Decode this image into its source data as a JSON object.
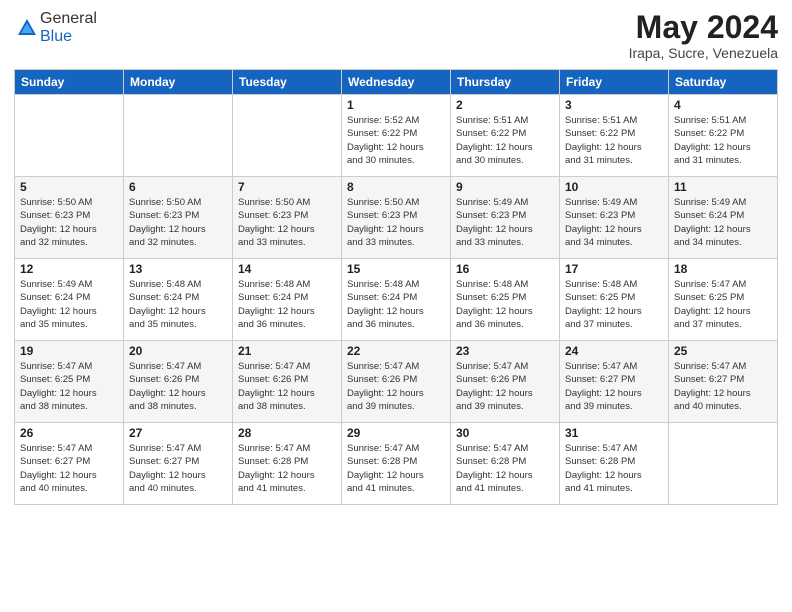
{
  "logo": {
    "general": "General",
    "blue": "Blue"
  },
  "header": {
    "month_year": "May 2024",
    "location": "Irapa, Sucre, Venezuela"
  },
  "weekdays": [
    "Sunday",
    "Monday",
    "Tuesday",
    "Wednesday",
    "Thursday",
    "Friday",
    "Saturday"
  ],
  "weeks": [
    [
      {
        "day": "",
        "info": ""
      },
      {
        "day": "",
        "info": ""
      },
      {
        "day": "",
        "info": ""
      },
      {
        "day": "1",
        "info": "Sunrise: 5:52 AM\nSunset: 6:22 PM\nDaylight: 12 hours\nand 30 minutes."
      },
      {
        "day": "2",
        "info": "Sunrise: 5:51 AM\nSunset: 6:22 PM\nDaylight: 12 hours\nand 30 minutes."
      },
      {
        "day": "3",
        "info": "Sunrise: 5:51 AM\nSunset: 6:22 PM\nDaylight: 12 hours\nand 31 minutes."
      },
      {
        "day": "4",
        "info": "Sunrise: 5:51 AM\nSunset: 6:22 PM\nDaylight: 12 hours\nand 31 minutes."
      }
    ],
    [
      {
        "day": "5",
        "info": "Sunrise: 5:50 AM\nSunset: 6:23 PM\nDaylight: 12 hours\nand 32 minutes."
      },
      {
        "day": "6",
        "info": "Sunrise: 5:50 AM\nSunset: 6:23 PM\nDaylight: 12 hours\nand 32 minutes."
      },
      {
        "day": "7",
        "info": "Sunrise: 5:50 AM\nSunset: 6:23 PM\nDaylight: 12 hours\nand 33 minutes."
      },
      {
        "day": "8",
        "info": "Sunrise: 5:50 AM\nSunset: 6:23 PM\nDaylight: 12 hours\nand 33 minutes."
      },
      {
        "day": "9",
        "info": "Sunrise: 5:49 AM\nSunset: 6:23 PM\nDaylight: 12 hours\nand 33 minutes."
      },
      {
        "day": "10",
        "info": "Sunrise: 5:49 AM\nSunset: 6:23 PM\nDaylight: 12 hours\nand 34 minutes."
      },
      {
        "day": "11",
        "info": "Sunrise: 5:49 AM\nSunset: 6:24 PM\nDaylight: 12 hours\nand 34 minutes."
      }
    ],
    [
      {
        "day": "12",
        "info": "Sunrise: 5:49 AM\nSunset: 6:24 PM\nDaylight: 12 hours\nand 35 minutes."
      },
      {
        "day": "13",
        "info": "Sunrise: 5:48 AM\nSunset: 6:24 PM\nDaylight: 12 hours\nand 35 minutes."
      },
      {
        "day": "14",
        "info": "Sunrise: 5:48 AM\nSunset: 6:24 PM\nDaylight: 12 hours\nand 36 minutes."
      },
      {
        "day": "15",
        "info": "Sunrise: 5:48 AM\nSunset: 6:24 PM\nDaylight: 12 hours\nand 36 minutes."
      },
      {
        "day": "16",
        "info": "Sunrise: 5:48 AM\nSunset: 6:25 PM\nDaylight: 12 hours\nand 36 minutes."
      },
      {
        "day": "17",
        "info": "Sunrise: 5:48 AM\nSunset: 6:25 PM\nDaylight: 12 hours\nand 37 minutes."
      },
      {
        "day": "18",
        "info": "Sunrise: 5:47 AM\nSunset: 6:25 PM\nDaylight: 12 hours\nand 37 minutes."
      }
    ],
    [
      {
        "day": "19",
        "info": "Sunrise: 5:47 AM\nSunset: 6:25 PM\nDaylight: 12 hours\nand 38 minutes."
      },
      {
        "day": "20",
        "info": "Sunrise: 5:47 AM\nSunset: 6:26 PM\nDaylight: 12 hours\nand 38 minutes."
      },
      {
        "day": "21",
        "info": "Sunrise: 5:47 AM\nSunset: 6:26 PM\nDaylight: 12 hours\nand 38 minutes."
      },
      {
        "day": "22",
        "info": "Sunrise: 5:47 AM\nSunset: 6:26 PM\nDaylight: 12 hours\nand 39 minutes."
      },
      {
        "day": "23",
        "info": "Sunrise: 5:47 AM\nSunset: 6:26 PM\nDaylight: 12 hours\nand 39 minutes."
      },
      {
        "day": "24",
        "info": "Sunrise: 5:47 AM\nSunset: 6:27 PM\nDaylight: 12 hours\nand 39 minutes."
      },
      {
        "day": "25",
        "info": "Sunrise: 5:47 AM\nSunset: 6:27 PM\nDaylight: 12 hours\nand 40 minutes."
      }
    ],
    [
      {
        "day": "26",
        "info": "Sunrise: 5:47 AM\nSunset: 6:27 PM\nDaylight: 12 hours\nand 40 minutes."
      },
      {
        "day": "27",
        "info": "Sunrise: 5:47 AM\nSunset: 6:27 PM\nDaylight: 12 hours\nand 40 minutes."
      },
      {
        "day": "28",
        "info": "Sunrise: 5:47 AM\nSunset: 6:28 PM\nDaylight: 12 hours\nand 41 minutes."
      },
      {
        "day": "29",
        "info": "Sunrise: 5:47 AM\nSunset: 6:28 PM\nDaylight: 12 hours\nand 41 minutes."
      },
      {
        "day": "30",
        "info": "Sunrise: 5:47 AM\nSunset: 6:28 PM\nDaylight: 12 hours\nand 41 minutes."
      },
      {
        "day": "31",
        "info": "Sunrise: 5:47 AM\nSunset: 6:28 PM\nDaylight: 12 hours\nand 41 minutes."
      },
      {
        "day": "",
        "info": ""
      }
    ]
  ]
}
